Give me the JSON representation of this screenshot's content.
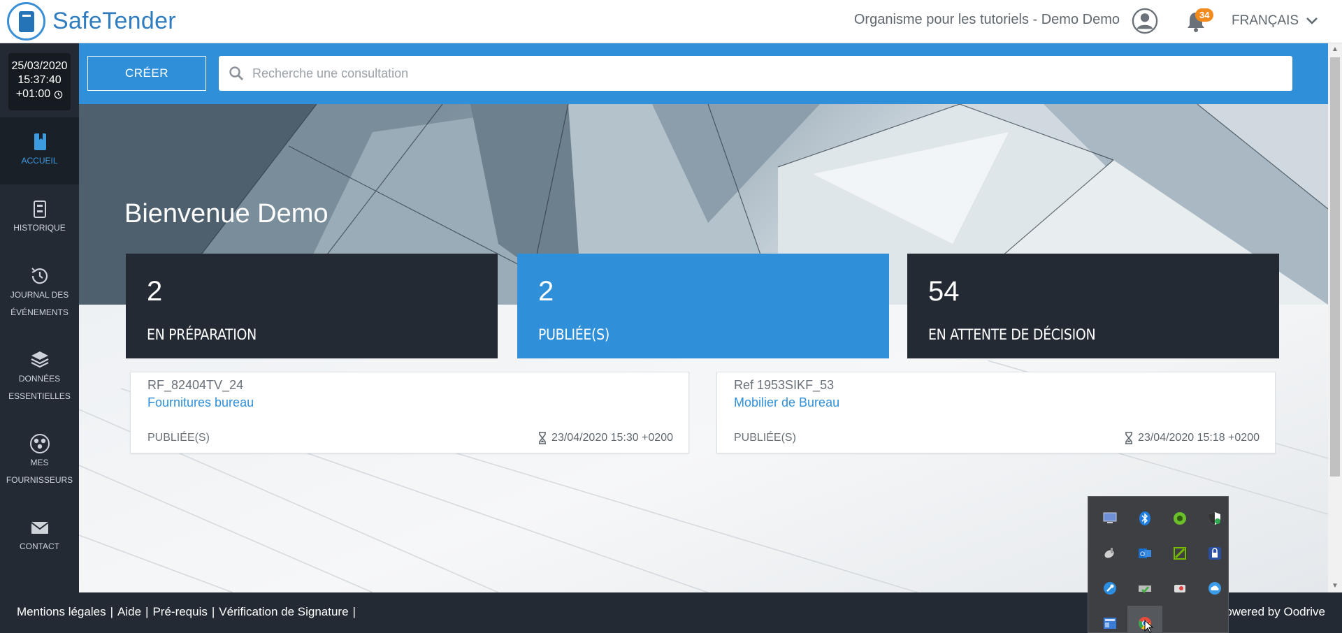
{
  "header": {
    "logo_text": "SafeTender",
    "organisation": "Organisme pour les tutoriels - Demo Demo",
    "notifications_count": "34",
    "language": "FRANÇAIS"
  },
  "sidebar": {
    "clock": {
      "date": "25/03/2020",
      "time": "15:37:40",
      "timezone": "+01:00"
    },
    "items": [
      {
        "label": "ACCUEIL",
        "icon": "book-icon",
        "active": true
      },
      {
        "label": "HISTORIQUE",
        "icon": "archive-icon"
      },
      {
        "label_line1": "JOURNAL DES",
        "label_line2": "ÉVÉNEMENTS",
        "icon": "history-icon"
      },
      {
        "label_line1": "DONNÉES",
        "label_line2": "ESSENTIELLES",
        "icon": "layers-icon"
      },
      {
        "label_line1": "MES",
        "label_line2": "FOURNISSEURS",
        "icon": "users-icon"
      },
      {
        "label": "CONTACT",
        "icon": "envelope-icon"
      }
    ]
  },
  "toolbar": {
    "create_label": "CRÉER",
    "search_placeholder": "Recherche une consultation"
  },
  "main": {
    "welcome": "Bienvenue Demo",
    "stats": [
      {
        "value": "2",
        "label": "EN PRÉPARATION"
      },
      {
        "value": "2",
        "label": "PUBLIÉE(S)"
      },
      {
        "value": "54",
        "label": "EN ATTENTE DE DÉCISION"
      }
    ],
    "consultations": [
      {
        "ref": "RF_82404TV_24",
        "title": "Fournitures bureau",
        "status": "PUBLIÉE(S)",
        "deadline": "23/04/2020 15:30 +0200"
      },
      {
        "ref": "Ref 1953SIKF_53",
        "title": "Mobilier de Bureau",
        "status": "PUBLIÉE(S)",
        "deadline": "23/04/2020 15:18 +0200"
      }
    ]
  },
  "footer": {
    "links": [
      "Mentions légales",
      "Aide",
      "Pré-requis",
      "Vérification de Signature"
    ],
    "powered": "owered by Oodrive"
  },
  "tray": {
    "icons": [
      "monitor-icon",
      "bluetooth-icon",
      "green-circle-icon",
      "shield-icon",
      "satellite-icon",
      "outlook-icon",
      "nvidia-icon",
      "lock-icon",
      "wrench-icon",
      "usb-drive-icon",
      "camera-icon",
      "cloud-icon",
      "network-icon",
      "chrome-icon"
    ],
    "colors": {
      "monitor": "#6f8fd6",
      "bluetooth": "#1f7de0",
      "green": "#6bbf2a",
      "shield": "#ffffff",
      "satellite": "#d0d0d0",
      "outlook": "#1a6cc9",
      "nvidia": "#76b900",
      "lock": "#2b4fa0",
      "wrench": "#2a8de0",
      "usb": "#8bc34a",
      "camera": "#e04040",
      "cloud": "#3a9be8",
      "network": "#3a7bd5",
      "chrome": "#e84a3c"
    }
  },
  "colors": {
    "brand_blue": "#2f8fd8",
    "dark": "#232a33",
    "badge_orange": "#f28a1c"
  }
}
